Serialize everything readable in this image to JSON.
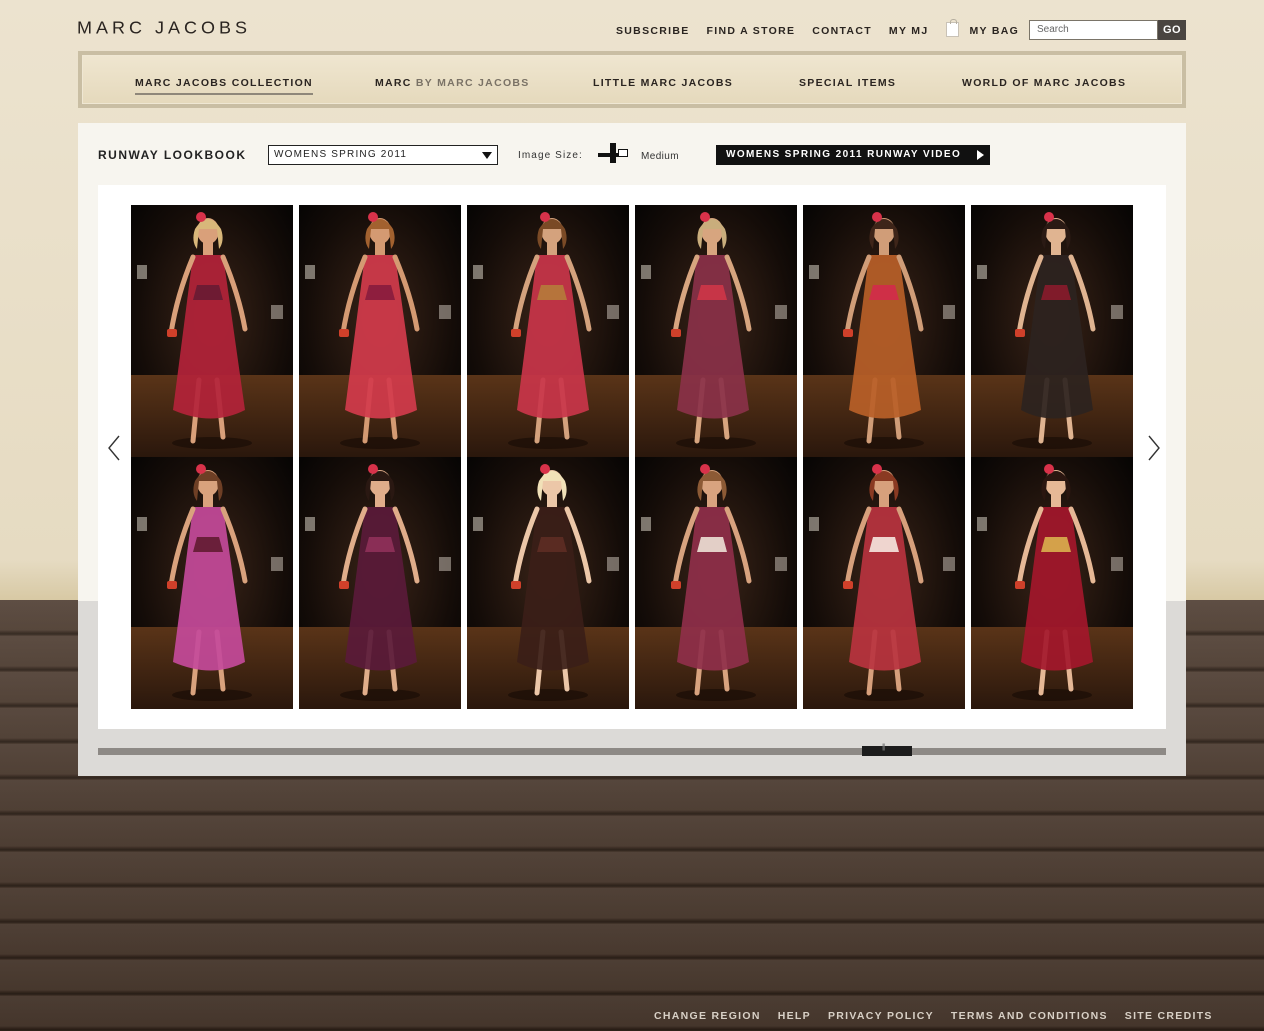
{
  "brand": {
    "logo_text": "MARC JACOBS"
  },
  "top_nav": {
    "items": [
      "SUBSCRIBE",
      "FIND A STORE",
      "CONTACT",
      "MY MJ",
      "MY BAG"
    ],
    "search_placeholder": "Search",
    "go_label": "GO"
  },
  "main_nav": {
    "items": [
      {
        "label": "MARC JACOBS COLLECTION",
        "active": true
      },
      {
        "label_a": "MARC",
        "label_b": " BY MARC JACOBS"
      },
      {
        "label": "LITTLE MARC JACOBS"
      },
      {
        "label": "SPECIAL ITEMS"
      },
      {
        "label": "WORLD OF MARC JACOBS"
      }
    ]
  },
  "lookbook": {
    "title": "RUNWAY LOOKBOOK",
    "season_selected": "WOMENS SPRING 2011",
    "image_size_label": "Image Size:",
    "image_size_value": "Medium",
    "video_label": "WOMENS SPRING 2011 RUNWAY VIDEO",
    "looks": [
      {
        "dress": "#b3233a",
        "accent": "#6e1b33",
        "skin": "#d9a07a",
        "hair": "#d8b77a"
      },
      {
        "dress": "#d23b4c",
        "accent": "#8e1e3e",
        "skin": "#d49a72",
        "hair": "#a2612f"
      },
      {
        "dress": "#c9354a",
        "accent": "#b6743b",
        "skin": "#d4a27d",
        "hair": "#7a4a26"
      },
      {
        "dress": "#8a3149",
        "accent": "#c73547",
        "skin": "#d7a57f",
        "hair": "#c9ad7c"
      },
      {
        "dress": "#b86028",
        "accent": "#cf2f47",
        "skin": "#d09d78",
        "hair": "#3e2519"
      },
      {
        "dress": "#2c2320",
        "accent": "#801b2a",
        "skin": "#e0b491",
        "hair": "#2a1a14"
      },
      {
        "dress": "#c44a9a",
        "accent": "#6a1f3a",
        "skin": "#d9a27d",
        "hair": "#6e3f25"
      },
      {
        "dress": "#5a1a3a",
        "accent": "#8a2e56",
        "skin": "#e0ad8a",
        "hair": "#2a1812"
      },
      {
        "dress": "#3b1e18",
        "accent": "#5a2b22",
        "skin": "#ecc7a8",
        "hair": "#f1e1b8"
      },
      {
        "dress": "#8f2f4a",
        "accent": "#e3cfc7",
        "skin": "#d8a37f",
        "hair": "#8c5a35"
      },
      {
        "dress": "#b8333f",
        "accent": "#efd5cf",
        "skin": "#d7a07c",
        "hair": "#8a3a22"
      },
      {
        "dress": "#a3172b",
        "accent": "#d4a14a",
        "skin": "#e6b896",
        "hair": "#2a1610"
      }
    ]
  },
  "footer": {
    "items": [
      "CHANGE REGION",
      "HELP",
      "PRIVACY POLICY",
      "TERMS AND CONDITIONS",
      "SITE CREDITS"
    ]
  },
  "colors": {
    "page_bg": "#e8dfc8",
    "floor": "#4a3a2e",
    "nav_border": "#c9bea3",
    "dark": "#111111"
  }
}
